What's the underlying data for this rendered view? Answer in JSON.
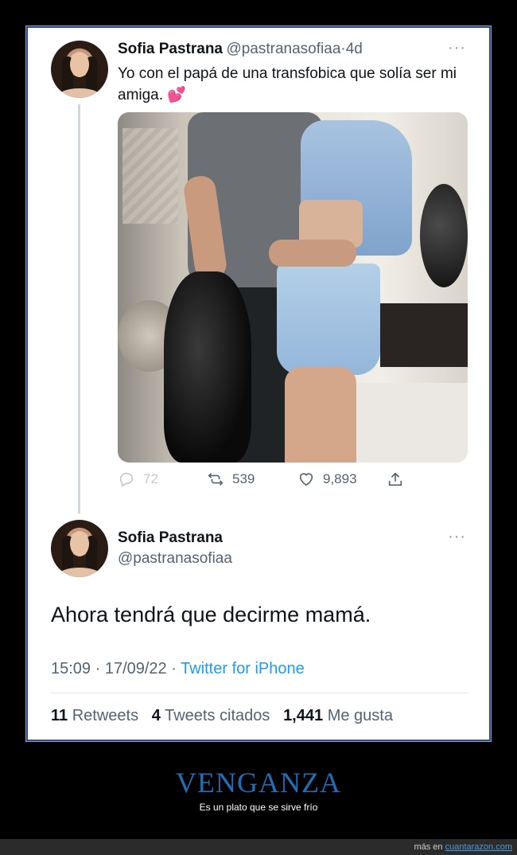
{
  "tweet1": {
    "name": "Sofia Pastrana",
    "handle": "@pastranasofiaa",
    "sep": "·",
    "time": "4d",
    "more": "···",
    "text": "Yo con el papá de una transfobica que solía ser mi amiga.",
    "emoji": "💕",
    "replies": "72",
    "retweets": "539",
    "likes": "9,893"
  },
  "tweet2": {
    "name": "Sofia Pastrana",
    "handle": "@pastranasofiaa",
    "more": "···",
    "text": "Ahora tendrá que decirme mamá.",
    "time": "15:09 · 17/09/22",
    "sep": " · ",
    "source": "Twitter for iPhone",
    "retweets_count": "11",
    "retweets_label": "Retweets",
    "quotes_count": "4",
    "quotes_label": "Tweets citados",
    "likes_count": "1,441",
    "likes_label": "Me gusta"
  },
  "caption": {
    "title": "VENGANZA",
    "subtitle": "Es un plato que se sirve frío"
  },
  "footer": {
    "prefix": "más en",
    "site": "cuantarazon.com"
  },
  "colors": {
    "link": "#1d9bf0",
    "caption_title": "#1e6fb8",
    "card_border": "#2e4a83"
  }
}
